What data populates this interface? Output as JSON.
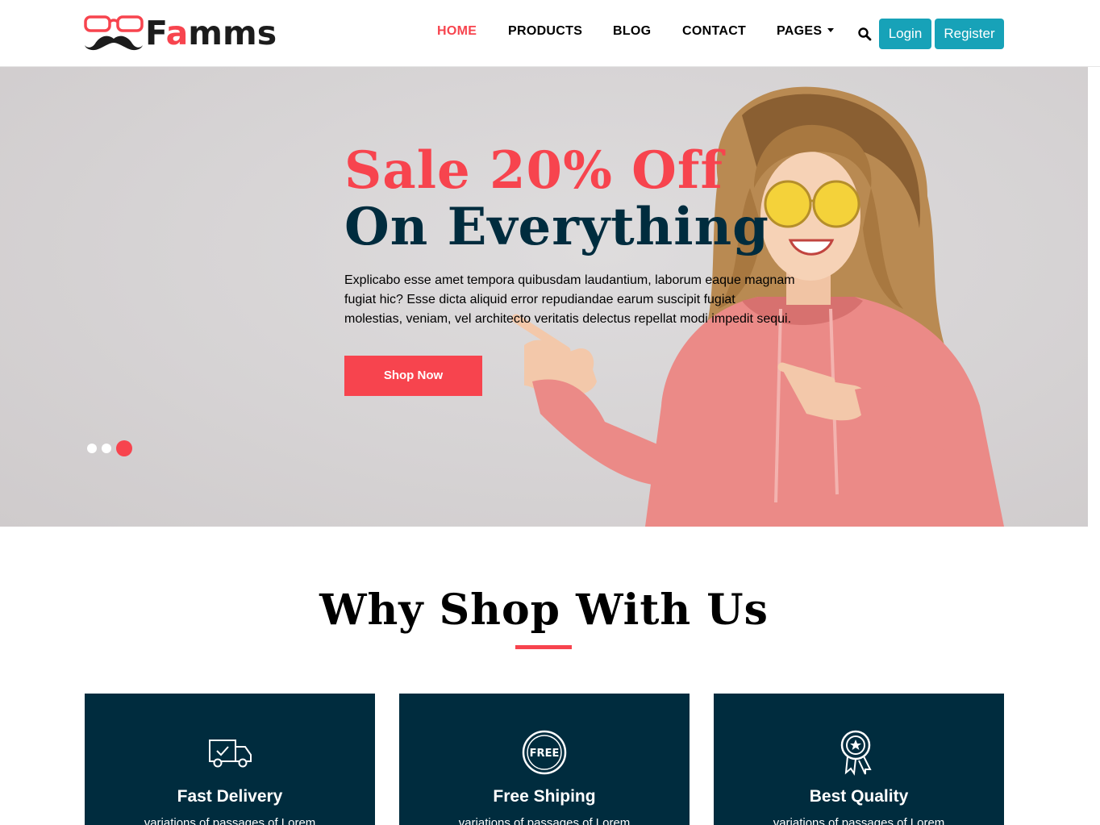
{
  "brand": {
    "name_prefix": "F",
    "name_accent": "a",
    "name_suffix": "mms",
    "icon": "glasses-mustache-logo",
    "accent_color": "#f7444e",
    "dark_color": "#002c3e"
  },
  "nav": {
    "items": [
      {
        "label": "Home",
        "active": true
      },
      {
        "label": "Products"
      },
      {
        "label": "Blog"
      },
      {
        "label": "Contact"
      },
      {
        "label": "Pages",
        "dropdown": true
      }
    ],
    "search_icon": "search-icon",
    "login_label": "Login",
    "register_label": "Register",
    "button_color": "#17a2b8"
  },
  "hero": {
    "title_line1": "Sale 20% Off",
    "title_line2": "On Everything",
    "text": "Explicabo esse amet tempora quibusdam laudantium, laborum eaque magnam fugiat hic? Esse dicta aliquid error repudiandae earum suscipit fugiat molestias, veniam, vel architecto veritatis delectus repellat modi impedit sequi.",
    "button_label": "Shop Now",
    "slides_total": 3,
    "active_slide": 3
  },
  "why": {
    "title": "Why Shop With Us",
    "cards": [
      {
        "title": "Fast Delivery",
        "text": "variations of passages of Lorem",
        "icon": "delivery-truck-icon"
      },
      {
        "title": "Free Shiping",
        "text": "variations of passages of Lorem",
        "icon": "free-badge-icon"
      },
      {
        "title": "Best Quality",
        "text": "variations of passages of Lorem",
        "icon": "quality-award-icon"
      }
    ]
  }
}
